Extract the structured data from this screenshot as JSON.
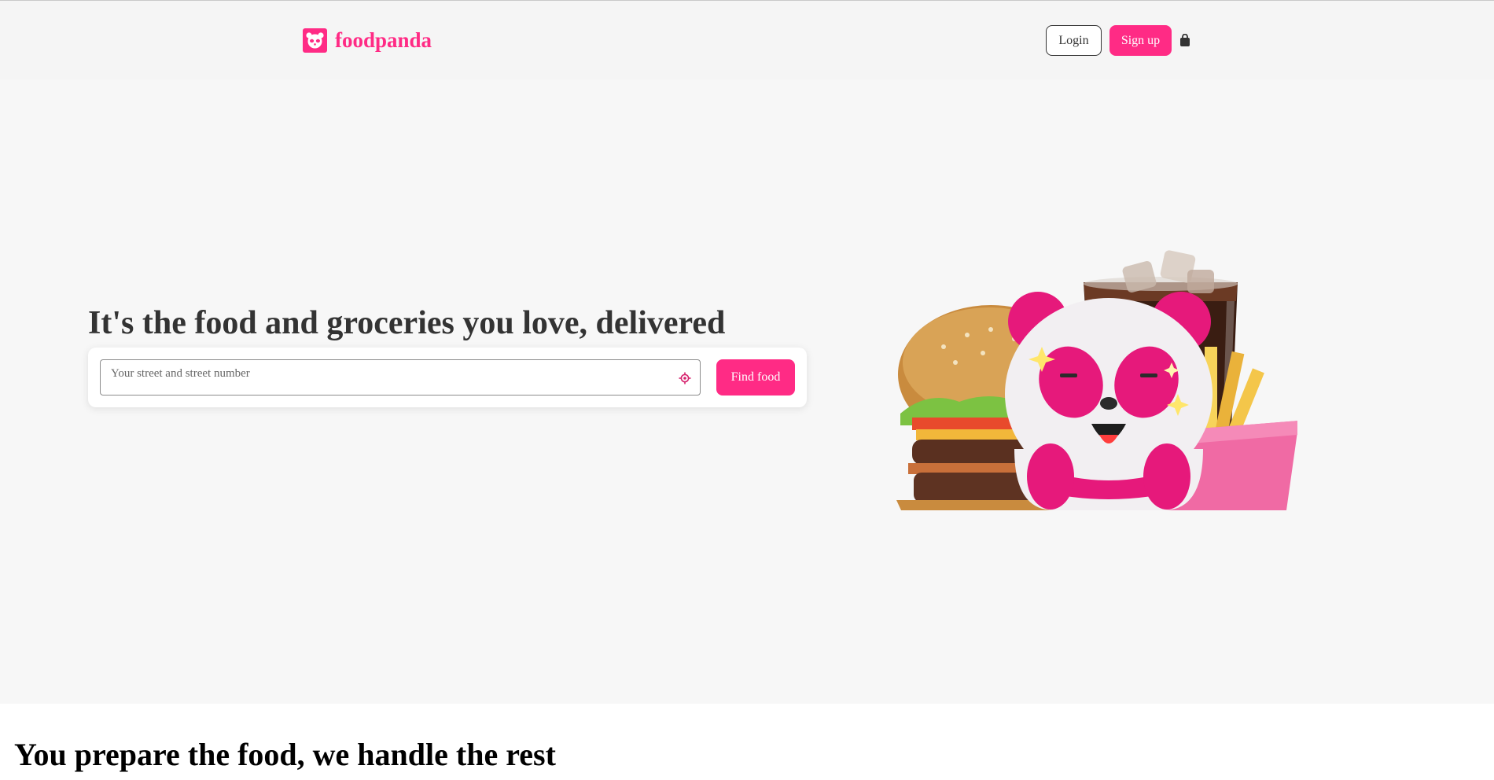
{
  "brand": {
    "name": "foodpanda",
    "color": "#ff2b85"
  },
  "header": {
    "login_label": "Login",
    "signup_label": "Sign up",
    "cart_icon": "shopping-bag-icon"
  },
  "hero": {
    "title": "It's the food and groceries you love, delivered",
    "search": {
      "value": "",
      "placeholder": "Your street and street number",
      "locate_icon": "crosshair-locate-icon",
      "button_label": "Find food"
    },
    "illustration": "panda-mascot-with-burger-cola-fries"
  },
  "section": {
    "title": "You prepare the food, we handle the rest"
  }
}
